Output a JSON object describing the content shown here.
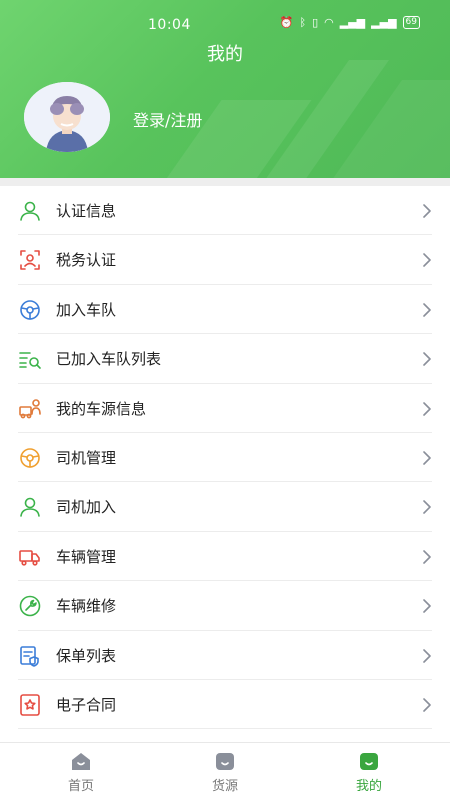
{
  "status": {
    "time": "10:04",
    "battery": "69"
  },
  "header": {
    "title": "我的",
    "login_text": "登录/注册"
  },
  "menu": [
    {
      "label": "认证信息",
      "icon": "person-icon",
      "color": "#3bb34a"
    },
    {
      "label": "税务认证",
      "icon": "face-scan-icon",
      "color": "#e54d42"
    },
    {
      "label": "加入车队",
      "icon": "steering-wheel-icon",
      "color": "#3b7dd8"
    },
    {
      "label": "已加入车队列表",
      "icon": "list-search-icon",
      "color": "#3bb34a"
    },
    {
      "label": "我的车源信息",
      "icon": "truck-person-icon",
      "color": "#e07a3a"
    },
    {
      "label": "司机管理",
      "icon": "steering-wheel-icon",
      "color": "#f0a030"
    },
    {
      "label": "司机加入",
      "icon": "person-icon",
      "color": "#3bb34a"
    },
    {
      "label": "车辆管理",
      "icon": "truck-icon",
      "color": "#e54d42"
    },
    {
      "label": "车辆维修",
      "icon": "wrench-icon",
      "color": "#3bb34a"
    },
    {
      "label": "保单列表",
      "icon": "document-shield-icon",
      "color": "#3b7dd8"
    },
    {
      "label": "电子合同",
      "icon": "contract-star-icon",
      "color": "#e54d42"
    }
  ],
  "tabbar": {
    "tabs": [
      {
        "label": "首页",
        "icon": "home-icon",
        "active": false
      },
      {
        "label": "货源",
        "icon": "cargo-icon",
        "active": false
      },
      {
        "label": "我的",
        "icon": "profile-icon",
        "active": true
      }
    ],
    "active_color": "#3aa63f",
    "inactive_color": "#8a8f9a"
  }
}
